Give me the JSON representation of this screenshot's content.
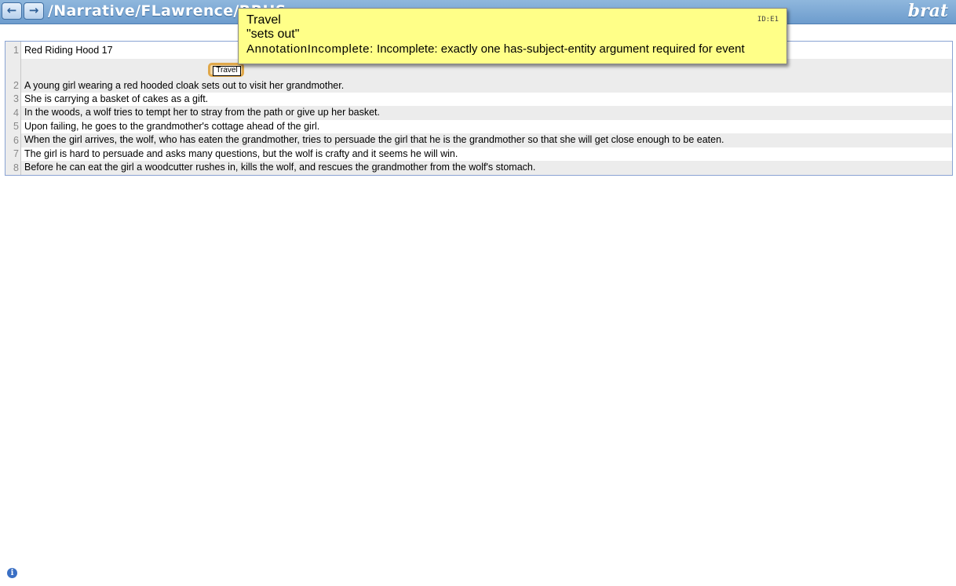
{
  "header": {
    "prev_icon": "←",
    "next_icon": "→",
    "doc_path": "/Narrative/FLawrence/RRHS",
    "logo": "brat"
  },
  "document": {
    "lines": [
      {
        "num": "1",
        "text": "Red Riding Hood 17"
      },
      {
        "num": "2",
        "text": "A young girl wearing a red hooded cloak sets out to visit her grandmother."
      },
      {
        "num": "3",
        "text": "She is carrying a basket of cakes as a gift."
      },
      {
        "num": "4",
        "text": "In the woods, a wolf tries to tempt her to stray from the path or give up her basket."
      },
      {
        "num": "5",
        "text": "Upon failing, he goes to the grandmother's cottage ahead of the girl."
      },
      {
        "num": "6",
        "text": "When the girl arrives, the wolf, who has eaten the grandmother, tries to persuade the girl that he is the grandmother so that she will get close enough to be eaten."
      },
      {
        "num": "7",
        "text": "The girl is hard to persuade and asks many questions, but the wolf is crafty and it seems he will win."
      },
      {
        "num": "8",
        "text": "Before he can eat the girl a woodcutter rushes in, kills the wolf, and rescues the grandmother from the wolf's stomach."
      }
    ],
    "annotation_label": "Travel"
  },
  "tooltip": {
    "type": "Travel",
    "text": "\"sets out\"",
    "comment_type": "AnnotationIncomplete:",
    "comment": " Incomplete: exactly one has-subject-entity argument required for event",
    "id": "ID:E1"
  },
  "footer": {
    "info_icon": "i"
  },
  "colors": {
    "header": "#6d9ccd",
    "tooltip": "#ffff88",
    "annotation_border": "#e0a84a"
  }
}
